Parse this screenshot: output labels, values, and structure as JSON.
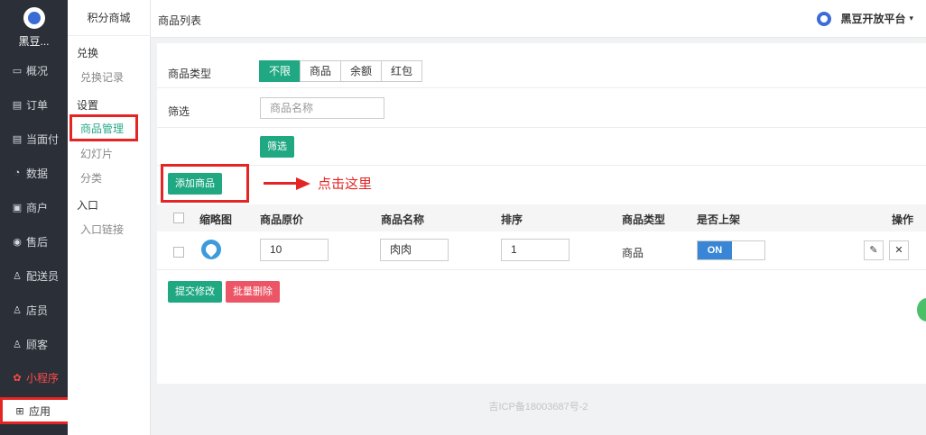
{
  "sidebar": {
    "title": "黑豆...",
    "items": [
      {
        "icon": "overview-icon",
        "glyph": "▭",
        "label": "概况"
      },
      {
        "icon": "order-icon",
        "glyph": "▤",
        "label": "订单"
      },
      {
        "icon": "facepay-icon",
        "glyph": "▤",
        "label": "当面付"
      },
      {
        "icon": "data-icon",
        "glyph": "◔",
        "label": "数据"
      },
      {
        "icon": "merchant-icon",
        "glyph": "▣",
        "label": "商户"
      },
      {
        "icon": "aftersale-icon",
        "glyph": "◉",
        "label": "售后"
      },
      {
        "icon": "courier-icon",
        "glyph": "♙",
        "label": "配送员"
      },
      {
        "icon": "clerk-icon",
        "glyph": "♙",
        "label": "店员"
      },
      {
        "icon": "customer-icon",
        "glyph": "♙",
        "label": "顾客"
      },
      {
        "icon": "miniprogram-icon",
        "glyph": "✿",
        "label": "小程序"
      },
      {
        "icon": "apps-icon",
        "glyph": "⊞",
        "label": "应用"
      }
    ]
  },
  "subbar": {
    "title": "积分商城",
    "group_exchange": "兑换",
    "exchange_record": "兑换记录",
    "group_settings": "设置",
    "goods_manage": "商品管理",
    "slides": "幻灯片",
    "category": "分类",
    "group_entry": "入口",
    "entry_link": "入口链接"
  },
  "header": {
    "crumb": "商品列表",
    "brand": "黑豆开放平台"
  },
  "filters": {
    "type_label": "商品类型",
    "type_options": [
      "不限",
      "商品",
      "余额",
      "红包"
    ],
    "filter_label": "筛选",
    "name_placeholder": "商品名称",
    "filter_button": "筛选"
  },
  "toolbar": {
    "add_button": "添加商品",
    "annotation": "点击这里"
  },
  "table": {
    "headers": [
      "缩略图",
      "商品原价",
      "商品名称",
      "排序",
      "商品类型",
      "是否上架",
      "操作"
    ],
    "rows": [
      {
        "price": "10",
        "name": "肉肉",
        "sort": "1",
        "type": "商品",
        "on_label": "ON"
      }
    ]
  },
  "actions": {
    "submit": "提交修改",
    "batch_delete": "批量删除"
  },
  "footer": {
    "icp": "吉ICP备18003687号-2"
  },
  "colors": {
    "accent": "#1fa882",
    "danger": "#ec5565",
    "highlight": "#e52424",
    "sidebar_bg": "#2b3038"
  }
}
